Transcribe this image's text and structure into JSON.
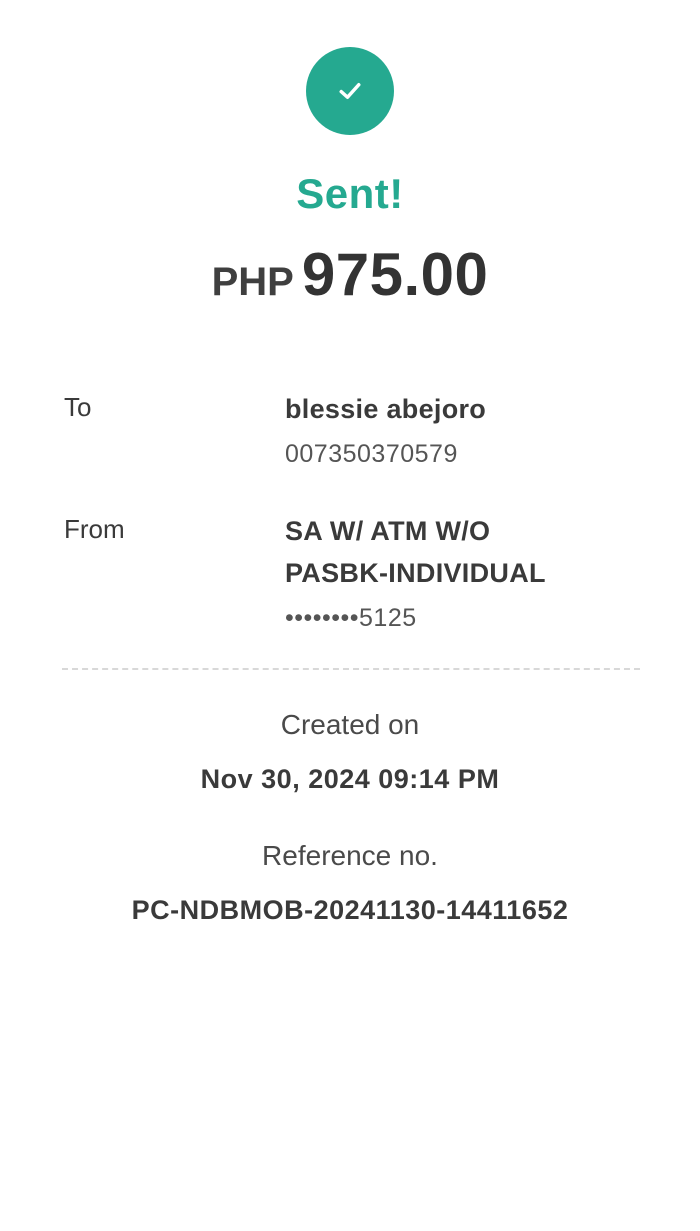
{
  "status": {
    "icon": "check-icon",
    "title": "Sent!",
    "accent_color": "#25a990"
  },
  "amount": {
    "currency": "PHP",
    "value": "975.00"
  },
  "recipient": {
    "label": "To",
    "name": "blessie abejoro",
    "account_number": "007350370579"
  },
  "source": {
    "label": "From",
    "account_type_line1": "SA W/ ATM W/O",
    "account_type_line2": "PASBK-INDIVIDUAL",
    "masked_account": "••••••••5125"
  },
  "created": {
    "label": "Created on",
    "value": "Nov 30, 2024 09:14 PM"
  },
  "reference": {
    "label": "Reference no.",
    "value": "PC-NDBMOB-20241130-14411652"
  }
}
